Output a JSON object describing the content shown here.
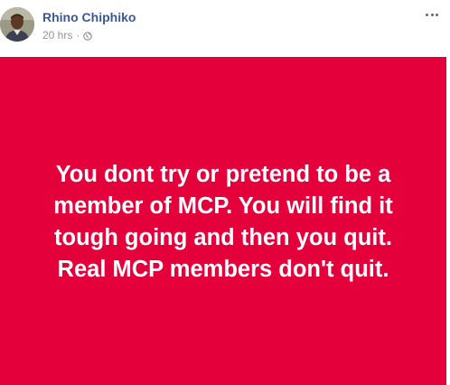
{
  "post": {
    "author": "Rhino Chiphiko",
    "timestamp": "20 hrs",
    "separator": "·",
    "privacy_icon": "globe-icon",
    "more_icon": "more-options-icon",
    "background_color": "#e4003b",
    "text_color": "#ffffff",
    "message": "You dont try or pretend to be a\nmember of MCP. You will find it\ntough going and then you quit.\nReal MCP members don't quit."
  }
}
